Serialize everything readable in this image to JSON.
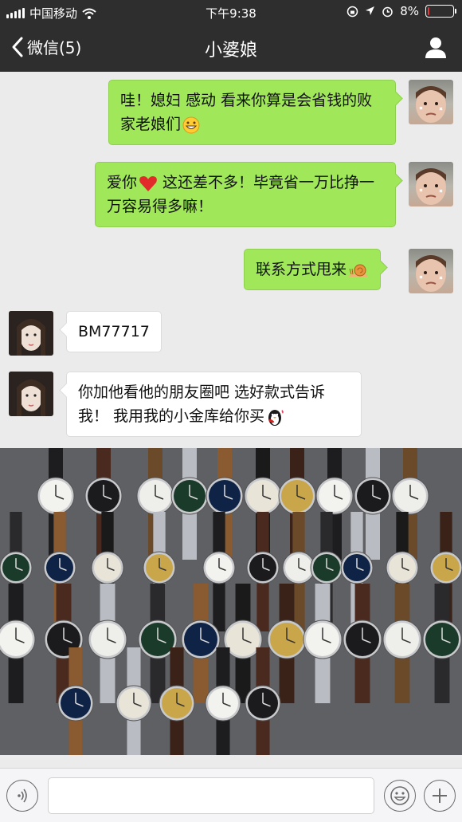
{
  "status_bar": {
    "carrier": "中国移动",
    "time": "下午9:38",
    "battery": "8%",
    "battery_level": 0.08
  },
  "nav": {
    "back_label": "微信(5)",
    "title": "小婆娘"
  },
  "messages": [
    {
      "side": "out",
      "text": "哇！媳妇 感动 看来你算是会省钱的败家老娘们",
      "emoji": "grinning-face"
    },
    {
      "side": "out",
      "text": "爱你",
      "emoji_inline": "red-heart",
      "text_after": " 这还差不多！毕竟省一万比挣一万容易得多嘛！"
    },
    {
      "side": "out",
      "text": "联系方式甩来",
      "emoji": "snail"
    },
    {
      "side": "in",
      "text": "BM77717"
    },
    {
      "side": "in",
      "text": "你加他看他的朋友圈吧 选好款式告诉我！ 我用我的小金库给你买",
      "emoji": "penguin"
    }
  ],
  "photo": {
    "subject": "wristwatches on floor"
  },
  "input_bar": {
    "text": ""
  },
  "colors": {
    "bar": "#2e2e2e",
    "bubble_out": "#a0e75a",
    "bubble_in": "#ffffff",
    "background": "#ebebeb"
  }
}
